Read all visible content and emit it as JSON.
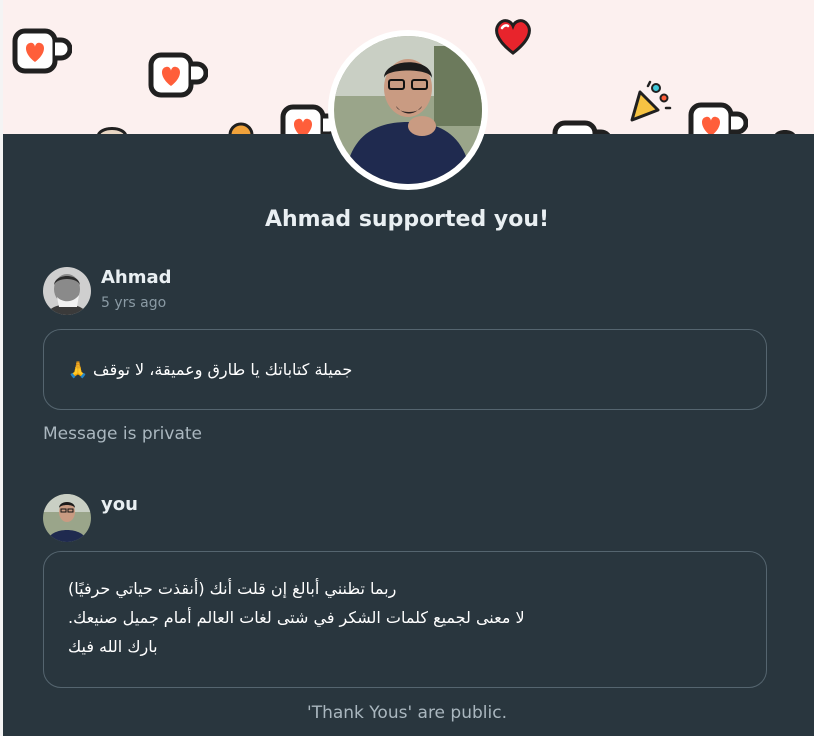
{
  "heading": "Ahmad supported you!",
  "supporter": {
    "name": "Ahmad",
    "time": "5 yrs ago",
    "message": "🙏 جميلة كتاباتك يا طارق وعميقة، لا توقف",
    "privacy_note": "Message is private"
  },
  "reply": {
    "name": "you",
    "lines": [
      "ربما تظنني أبالغ إن قلت أنك (أنقذت حياتي حرفيًا)",
      ".لا معنى لجميع كلمات الشكر في شتى لغات العالم أمام جميل صنيعك",
      "بارك الله فيك"
    ]
  },
  "public_note": "'Thank Yous' are public.",
  "colors": {
    "background": "#29363e",
    "banner": "#fcf0ef",
    "accent_heart": "#ff5e3a",
    "text_primary": "#e9eff2",
    "text_muted": "#8a9aa4"
  },
  "icons": [
    "coffee-cup-heart-icon",
    "red-heart-icon",
    "party-popper-icon"
  ]
}
